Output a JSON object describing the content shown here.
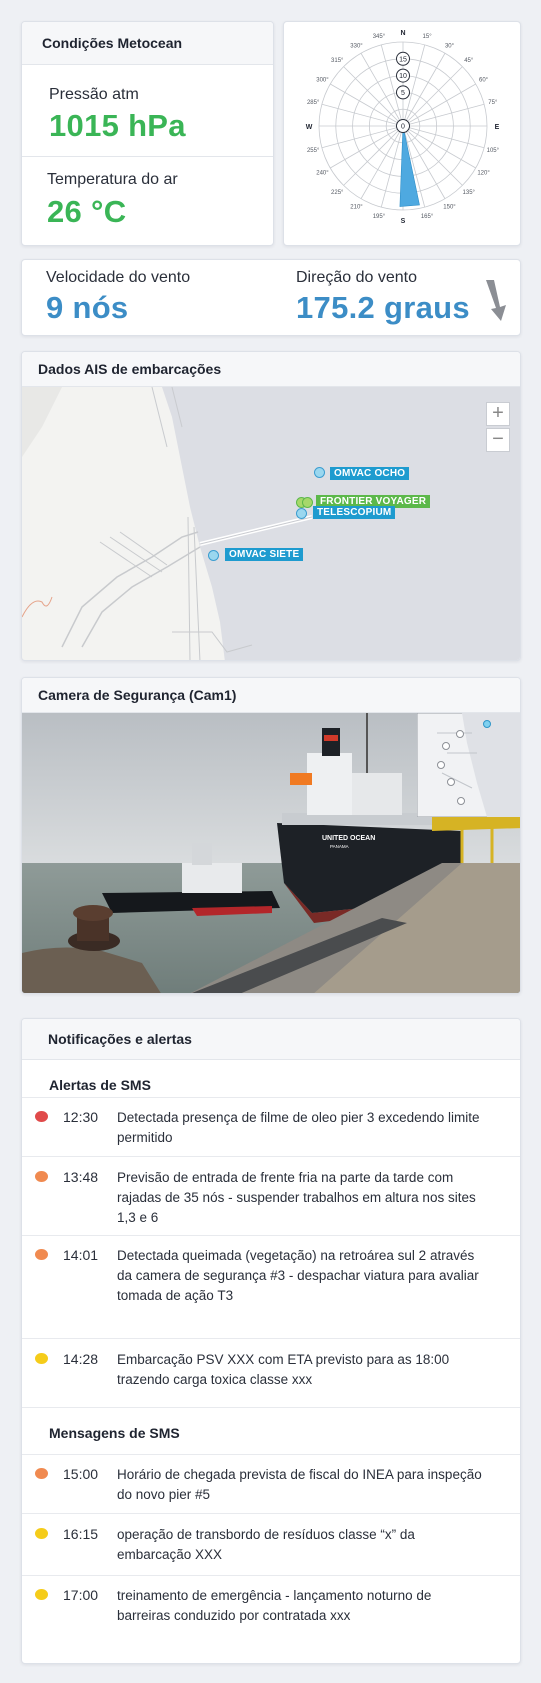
{
  "colors": {
    "green": "#3ab556",
    "blue": "#3c8dc6",
    "red": "#e04a4a",
    "orange": "#f08a50",
    "yellow": "#f5cc1a"
  },
  "metocean": {
    "title": "Condições Metocean",
    "pressure_label": "Pressão atm",
    "pressure_value": "1015 hPa",
    "temperature_label": "Temperatura do ar",
    "temperature_value": "26 °C"
  },
  "wind_rose": {
    "cardinals": {
      "n": "N",
      "e": "E",
      "s": "S",
      "w": "W"
    },
    "degree_labels": [
      "15°",
      "30°",
      "45°",
      "60°",
      "75°",
      "105°",
      "120°",
      "135°",
      "150°",
      "165°",
      "195°",
      "210°",
      "225°",
      "240°",
      "255°",
      "285°",
      "300°",
      "315°",
      "330°",
      "345°"
    ],
    "rings": [
      "15",
      "10",
      "5",
      "0"
    ],
    "direction_deg": 175.2
  },
  "wind": {
    "speed_label": "Velocidade do vento",
    "speed_value": "9 nós",
    "direction_label": "Direção do vento",
    "direction_value": "175.2 graus",
    "arrow_icon": "wind-arrow-icon"
  },
  "ais": {
    "title": "Dados AIS de embarcações",
    "zoom_in": "+",
    "zoom_out": "−",
    "vessels": [
      {
        "name": "OMVAC OCHO",
        "color": "#1e9bcf"
      },
      {
        "name": "FRONTIER VOYAGER",
        "color": "#5cb84a"
      },
      {
        "name": "TELESCOPIUM",
        "color": "#1e9bcf"
      },
      {
        "name": "OMVAC SIETE",
        "color": "#1e9bcf"
      }
    ]
  },
  "camera": {
    "title": "Camera de Segurança (Cam1)",
    "ship_name": "UNITED OCEAN",
    "ship_flag": "PANAMA"
  },
  "notifications": {
    "title": "Notificações e alertas",
    "alerts_title": "Alertas de SMS",
    "alerts": [
      {
        "severity": "red",
        "time": "12:30",
        "text": "Detectada presença de filme de oleo pier 3 excedendo limite permitido"
      },
      {
        "severity": "orange",
        "time": "13:48",
        "text": "Previsão de entrada de frente fria na parte da tarde com rajadas de 35 nós - suspender trabalhos em altura nos sites 1,3 e 6"
      },
      {
        "severity": "orange",
        "time": "14:01",
        "text": "Detectada queimada (vegetação) na retroárea sul 2 através da camera de segurança #3 - despachar viatura para avaliar tomada de ação T3"
      },
      {
        "severity": "yellow",
        "time": "14:28",
        "text": "Embarcação PSV XXX com ETA previsto para as 18:00 trazendo carga toxica classe xxx"
      }
    ],
    "messages_title": "Mensagens de SMS",
    "messages": [
      {
        "severity": "orange",
        "time": "15:00",
        "text": "Horário de chegada prevista de fiscal do INEA para inspeção do novo pier #5"
      },
      {
        "severity": "yellow",
        "time": "16:15",
        "text": "operação de transbordo de resíduos classe “x” da embarcação XXX"
      },
      {
        "severity": "yellow",
        "time": "17:00",
        "text": "treinamento de emergência - lançamento noturno de barreiras conduzido por contratada xxx"
      }
    ]
  }
}
